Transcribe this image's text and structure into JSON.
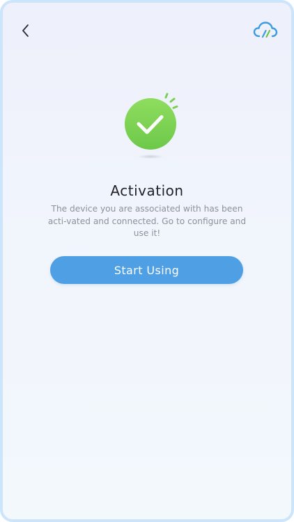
{
  "header": {
    "back_icon": "chevron-left-icon",
    "cloud_icon": "cloud-brand-icon"
  },
  "status": {
    "icon": "check-circle-icon",
    "title": "Activation",
    "description": "The device you are associated with has been acti-vated and connected. Go to configure and use it!"
  },
  "actions": {
    "start_label": "Start Using"
  },
  "colors": {
    "accent": "#4e9fe4",
    "success": "#7fd356",
    "frame_border": "#cde5fb",
    "title": "#1f2126",
    "description": "#8d9199"
  }
}
